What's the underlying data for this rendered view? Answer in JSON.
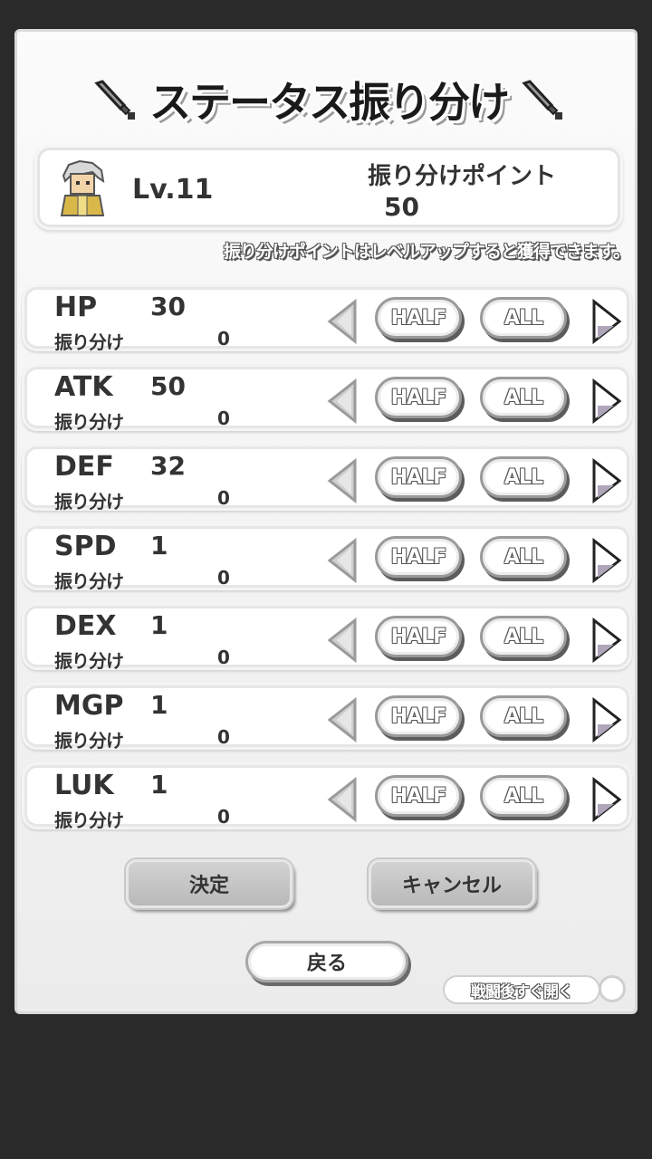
{
  "title": "ステータス振り分け",
  "player": {
    "level": "Lv.11",
    "points_label": "振り分けポイント",
    "points_value": "50"
  },
  "hint": "振り分けポイントはレベルアップすると獲得できます。",
  "stats": [
    {
      "name": "HP",
      "value": "30",
      "alloc_label": "振り分け",
      "alloc_value": "0"
    },
    {
      "name": "ATK",
      "value": "50",
      "alloc_label": "振り分け",
      "alloc_value": "0"
    },
    {
      "name": "DEF",
      "value": "32",
      "alloc_label": "振り分け",
      "alloc_value": "0"
    },
    {
      "name": "SPD",
      "value": "1",
      "alloc_label": "振り分け",
      "alloc_value": "0"
    },
    {
      "name": "DEX",
      "value": "1",
      "alloc_label": "振り分け",
      "alloc_value": "0"
    },
    {
      "name": "MGP",
      "value": "1",
      "alloc_label": "振り分け",
      "alloc_value": "0"
    },
    {
      "name": "LUK",
      "value": "1",
      "alloc_label": "振り分け",
      "alloc_value": "0"
    }
  ],
  "controls": {
    "half_label": "HALF",
    "all_label": "ALL"
  },
  "buttons": {
    "ok": "決定",
    "cancel": "キャンセル",
    "back": "戻る"
  },
  "open_after_battle": "戦闘後すぐ開く",
  "icons": {
    "title": "sword-icon",
    "avatar": "hero-avatar",
    "decrease": "arrow-left-icon",
    "increase": "arrow-right-icon"
  }
}
